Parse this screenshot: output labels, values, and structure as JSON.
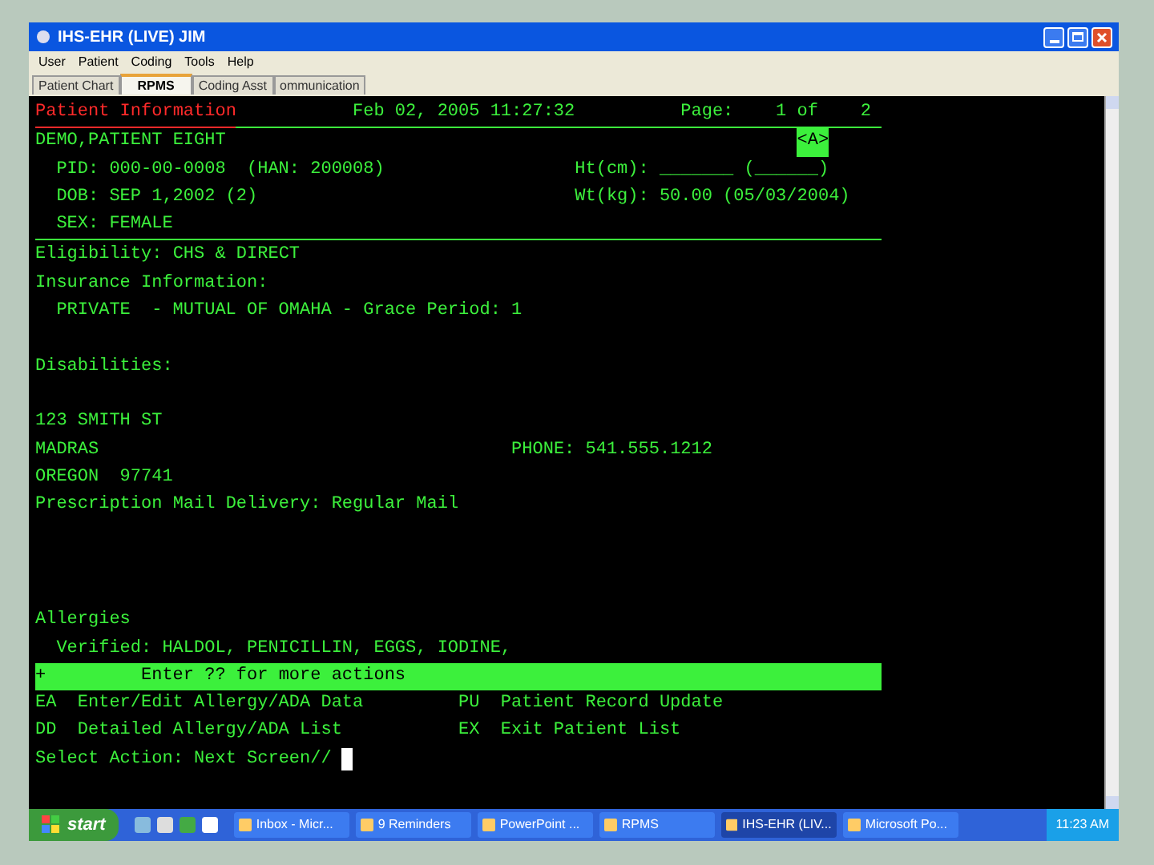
{
  "window": {
    "title": "IHS-EHR (LIVE) JIM"
  },
  "menu": [
    "User",
    "Patient",
    "Coding",
    "Tools",
    "Help"
  ],
  "tabs": [
    {
      "label": "Patient Chart",
      "selected": false
    },
    {
      "label": "RPMS",
      "selected": true
    },
    {
      "label": "Coding Asst",
      "selected": false
    },
    {
      "label": "ommunication",
      "selected": false
    }
  ],
  "terminal": {
    "header": {
      "title": "Patient Information",
      "datetime": "Feb 02, 2005 11:27:32",
      "page_label": "Page:",
      "page": "1 of",
      "pages": "2"
    },
    "patient": {
      "name": "DEMO,PATIENT EIGHT",
      "flag": "<A>",
      "left": [
        "PID: 000-00-0008  (HAN: 200008)",
        "DOB: SEP 1,2002 (2)",
        "SEX: FEMALE"
      ],
      "right": [
        "Ht(cm): _______ (______)",
        "Wt(kg): 50.00 (05/03/2004)"
      ]
    },
    "sections": [
      [
        {
          "text": "Eligibility: CHS & DIRECT"
        },
        {
          "text": "Insurance Information:",
          "children": [
            {
              "text": "PRIVATE  - MUTUAL OF OMAHA - Grace Period: 1"
            }
          ]
        }
      ],
      [
        {
          "text": "Disabilities:"
        }
      ],
      [
        {
          "text": "123 SMITH ST"
        },
        {
          "text": "MADRAS",
          "right": "PHONE: 541.555.1212"
        },
        {
          "text": "OREGON  97741"
        },
        {
          "text": "Prescription Mail Delivery: Regular Mail"
        }
      ]
    ],
    "allergies": {
      "text": "Allergies",
      "children": [
        {
          "text": "Verified: HALDOL, PENICILLIN, EGGS, IODINE,"
        }
      ]
    },
    "bar": {
      "mark": "+",
      "text": "Enter ?? for more actions"
    },
    "actions": [
      {
        "code": "EA",
        "label": "Enter/Edit Allergy/ADA Data"
      },
      {
        "code": "PU",
        "label": "Patient Record Update"
      },
      {
        "code": "DD",
        "label": "Detailed Allergy/ADA List"
      },
      {
        "code": "EX",
        "label": "Exit Patient List"
      }
    ],
    "prompt": "Select Action: Next Screen//"
  },
  "taskbar": {
    "start": "start",
    "items": [
      {
        "label": "Inbox - Micr...",
        "selected": false
      },
      {
        "label": "9 Reminders",
        "selected": false
      },
      {
        "label": "PowerPoint ...",
        "selected": false
      },
      {
        "label": "RPMS",
        "selected": false
      },
      {
        "label": "IHS-EHR (LIV...",
        "selected": true
      },
      {
        "label": "Microsoft Po...",
        "selected": false
      }
    ],
    "clock": "11:23 AM"
  }
}
